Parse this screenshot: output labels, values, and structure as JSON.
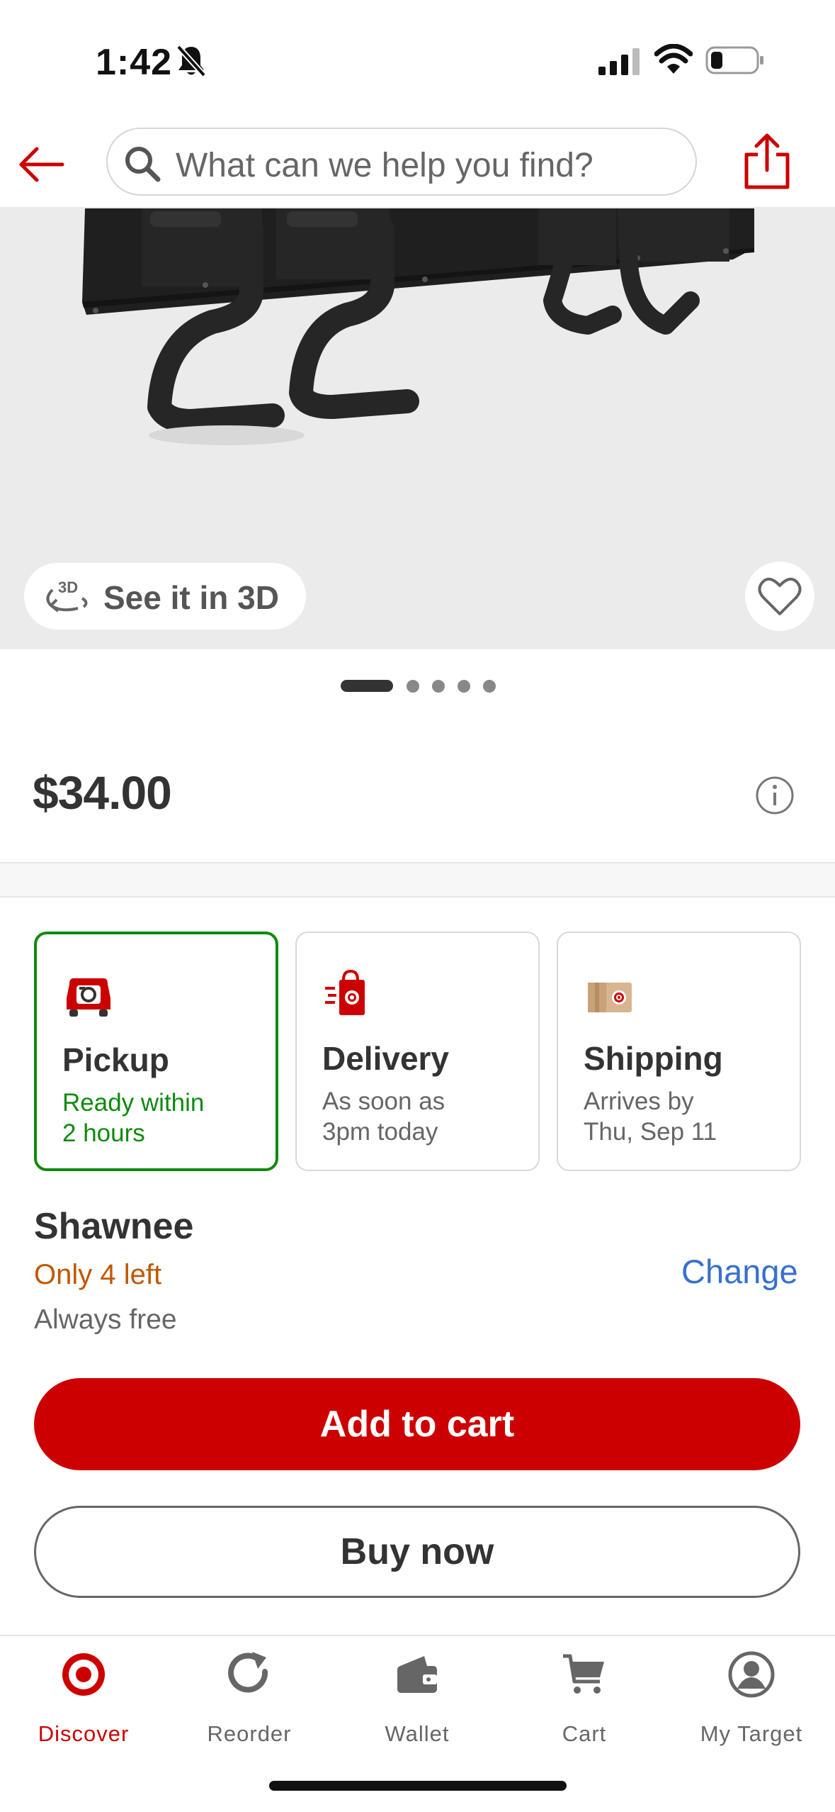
{
  "status_bar": {
    "time": "1:42"
  },
  "header": {
    "search_placeholder": "What can we help you find?"
  },
  "hero": {
    "view_3d_label": "See it in 3D",
    "icon_3d_text": "3D",
    "carousel_total": 5,
    "carousel_active": 1
  },
  "product": {
    "price": "$34.00"
  },
  "fulfillment": [
    {
      "title": "Pickup",
      "sub1": "Ready within",
      "sub2": "2 hours",
      "icon": "pickup-car-icon",
      "selected": true
    },
    {
      "title": "Delivery",
      "sub1": "As soon as",
      "sub2": "3pm today",
      "icon": "delivery-bag-icon",
      "selected": false
    },
    {
      "title": "Shipping",
      "sub1": "Arrives by",
      "sub2": "Thu, Sep 11",
      "icon": "shipping-box-icon",
      "selected": false
    }
  ],
  "store": {
    "name": "Shawnee",
    "stock": "Only 4 left",
    "note": "Always free",
    "change_label": "Change"
  },
  "actions": {
    "add_to_cart": "Add to cart",
    "buy_now": "Buy now"
  },
  "bottom_nav": [
    {
      "label": "Discover",
      "icon": "target-logo-icon",
      "active": true
    },
    {
      "label": "Reorder",
      "icon": "reorder-icon",
      "active": false
    },
    {
      "label": "Wallet",
      "icon": "wallet-icon",
      "active": false
    },
    {
      "label": "Cart",
      "icon": "cart-icon",
      "active": false
    },
    {
      "label": "My Target",
      "icon": "account-icon",
      "active": false
    }
  ],
  "colors": {
    "brand_red": "#cc0000",
    "pickup_green": "#0f8a0f",
    "stock_orange": "#c25700",
    "link_blue": "#3770cf"
  }
}
